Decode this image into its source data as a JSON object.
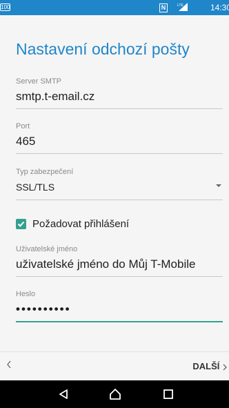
{
  "statusbar": {
    "nfc": "N",
    "signal": "LTE",
    "battery": "100",
    "time": "14:30"
  },
  "title": "Nastavení odchozí pošty",
  "fields": {
    "smtp_server": {
      "label": "Server SMTP",
      "value": "smtp.t-email.cz"
    },
    "port": {
      "label": "Port",
      "value": "465"
    },
    "security": {
      "label": "Typ zabezpečení",
      "value": "SSL/TLS"
    },
    "username": {
      "label": "Uživatelské jméno",
      "value": "uživatelské jméno do Můj T-Mobile"
    },
    "password": {
      "label": "Heslo",
      "value": "••••••••••"
    }
  },
  "require_login": {
    "label": "Požadovat přihlášení",
    "checked": true
  },
  "footer": {
    "prev_icon": "chevron-left",
    "next_label": "DALŠÍ"
  },
  "colors": {
    "accent": "#1f86c9",
    "focus": "#33a08e"
  },
  "navbar": {
    "icons": [
      "back-icon",
      "home-icon",
      "recents-icon"
    ]
  }
}
